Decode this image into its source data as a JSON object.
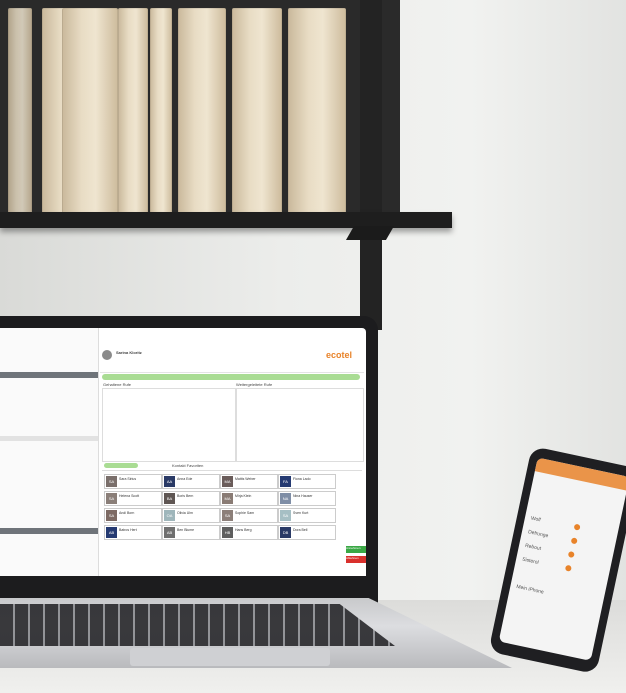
{
  "laptop_screen": {
    "brand": "ecotel",
    "header_name": "Sarina Kloritz",
    "panel_left": "Gehaltene Rufe",
    "panel_right": "Weitergeleitete Rufe",
    "tab_label": "Kontakt Favoriten",
    "buttons": {
      "accept": "Annehmen",
      "reject": "Ablehnen"
    },
    "tiles": [
      {
        "initials": "SA",
        "name": "Sara Sirius",
        "color": "#7a6f6b"
      },
      {
        "initials": "AA",
        "name": "Anna Ede",
        "color": "#2a3a66"
      },
      {
        "initials": "MA",
        "name": "Mattis Weber",
        "color": "#6a5c5a"
      },
      {
        "initials": "FA",
        "name": "Fiona Lado",
        "color": "#253a72"
      },
      {
        "initials": "SA",
        "name": "Helena Scott",
        "color": "#8a7e78"
      },
      {
        "initials": "BA",
        "name": "Boris Bern",
        "color": "#5f5653"
      },
      {
        "initials": "MA",
        "name": "Mirja Klein",
        "color": "#897b74"
      },
      {
        "initials": "NA",
        "name": "Nina Hauser",
        "color": "#7f8ea6"
      },
      {
        "initials": "SA",
        "name": "Andi Born",
        "color": "#7d6a64"
      },
      {
        "initials": "OA",
        "name": "Olivia Ulm",
        "color": "#9fb6bb"
      },
      {
        "initials": "SA",
        "name": "Sophie Sam",
        "color": "#8c7f79"
      },
      {
        "initials": "SA",
        "name": "Sven Kurt",
        "color": "#a6bfc4"
      },
      {
        "initials": "AB",
        "name": "Batros Hert",
        "color": "#253a72"
      },
      {
        "initials": "AB",
        "name": "Ben Blume",
        "color": "#6f6f6f"
      },
      {
        "initials": "HB",
        "name": "Hans Berg",
        "color": "#5e5e5e"
      },
      {
        "initials": "DB",
        "name": "Dora Bell",
        "color": "#2a3a66"
      }
    ]
  },
  "phone_screen": {
    "items": [
      "Wolf",
      "Defrunge",
      "Rebout",
      "Sisterol"
    ],
    "footer": "Mein iPhone"
  },
  "colors": {
    "brand_orange": "#e8832a",
    "accept_green": "#3aa845",
    "reject_red": "#d9302c",
    "accent_green": "#a9dc93"
  }
}
